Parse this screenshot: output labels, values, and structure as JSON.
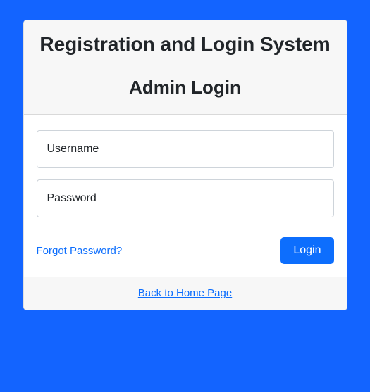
{
  "header": {
    "title": "Registration and Login System",
    "subtitle": "Admin Login"
  },
  "form": {
    "username_placeholder": "Username",
    "password_placeholder": "Password",
    "forgot_link": "Forgot Password?",
    "login_button": "Login"
  },
  "footer": {
    "home_link": "Back to Home Page"
  },
  "colors": {
    "background": "#1364ff",
    "card_bg": "#ffffff",
    "header_bg": "#f7f7f7",
    "primary": "#0d6efd"
  }
}
